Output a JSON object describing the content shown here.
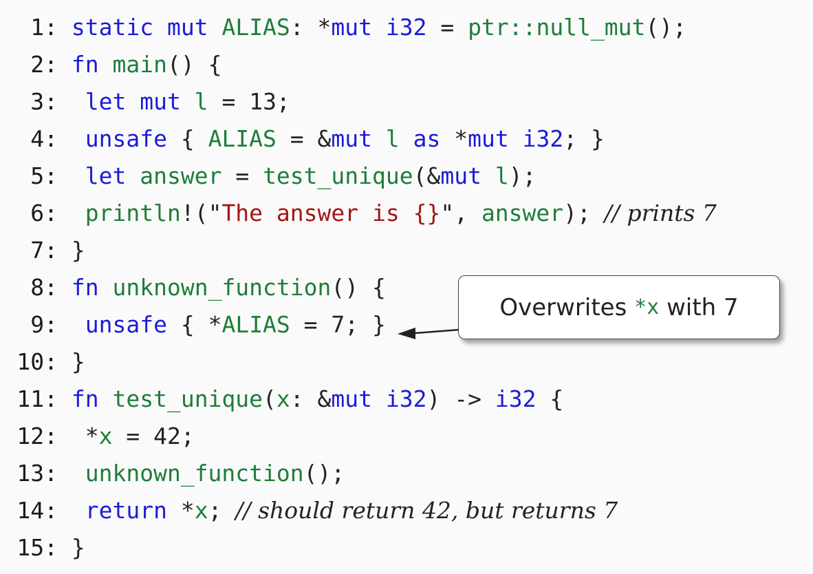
{
  "lines": [
    {
      "num": "1:",
      "tokens": [
        {
          "t": " "
        },
        {
          "t": "static",
          "c": "kw"
        },
        {
          "t": " "
        },
        {
          "t": "mut",
          "c": "kw"
        },
        {
          "t": " "
        },
        {
          "t": "ALIAS",
          "c": "fn"
        },
        {
          "t": ": *"
        },
        {
          "t": "mut",
          "c": "kw"
        },
        {
          "t": " "
        },
        {
          "t": "i32",
          "c": "kw"
        },
        {
          "t": " = "
        },
        {
          "t": "ptr::null_mut",
          "c": "fn"
        },
        {
          "t": "();"
        }
      ]
    },
    {
      "num": "2:",
      "tokens": [
        {
          "t": " "
        },
        {
          "t": "fn",
          "c": "kw"
        },
        {
          "t": " "
        },
        {
          "t": "main",
          "c": "fn"
        },
        {
          "t": "() {"
        }
      ]
    },
    {
      "num": "3:",
      "tokens": [
        {
          "t": "  "
        },
        {
          "t": "let",
          "c": "kw"
        },
        {
          "t": " "
        },
        {
          "t": "mut",
          "c": "kw"
        },
        {
          "t": " "
        },
        {
          "t": "l",
          "c": "fn"
        },
        {
          "t": " = 13;"
        }
      ]
    },
    {
      "num": "4:",
      "tokens": [
        {
          "t": "  "
        },
        {
          "t": "unsafe",
          "c": "kw"
        },
        {
          "t": " { "
        },
        {
          "t": "ALIAS",
          "c": "fn"
        },
        {
          "t": " = &"
        },
        {
          "t": "mut",
          "c": "kw"
        },
        {
          "t": " "
        },
        {
          "t": "l",
          "c": "fn"
        },
        {
          "t": " "
        },
        {
          "t": "as",
          "c": "kw"
        },
        {
          "t": " *"
        },
        {
          "t": "mut",
          "c": "kw"
        },
        {
          "t": " "
        },
        {
          "t": "i32",
          "c": "kw"
        },
        {
          "t": "; }"
        }
      ]
    },
    {
      "num": "5:",
      "tokens": [
        {
          "t": "  "
        },
        {
          "t": "let",
          "c": "kw"
        },
        {
          "t": " "
        },
        {
          "t": "answer",
          "c": "fn"
        },
        {
          "t": " = "
        },
        {
          "t": "test_unique",
          "c": "fn"
        },
        {
          "t": "(&"
        },
        {
          "t": "mut",
          "c": "kw"
        },
        {
          "t": " "
        },
        {
          "t": "l",
          "c": "fn"
        },
        {
          "t": ");"
        }
      ]
    },
    {
      "num": "6:",
      "tokens": [
        {
          "t": "  "
        },
        {
          "t": "println",
          "c": "fn"
        },
        {
          "t": "!(\""
        },
        {
          "t": "The answer is {}",
          "c": "str"
        },
        {
          "t": "\", "
        },
        {
          "t": "answer",
          "c": "fn"
        },
        {
          "t": "); "
        },
        {
          "t": "// prints 7",
          "c": "cm"
        }
      ]
    },
    {
      "num": "7:",
      "tokens": [
        {
          "t": " }"
        }
      ]
    },
    {
      "num": "8:",
      "tokens": [
        {
          "t": " "
        },
        {
          "t": "fn",
          "c": "kw"
        },
        {
          "t": " "
        },
        {
          "t": "unknown_function",
          "c": "fn"
        },
        {
          "t": "() {"
        }
      ]
    },
    {
      "num": "9:",
      "tokens": [
        {
          "t": "  "
        },
        {
          "t": "unsafe",
          "c": "kw"
        },
        {
          "t": " { *"
        },
        {
          "t": "ALIAS",
          "c": "fn"
        },
        {
          "t": " = 7; }"
        }
      ]
    },
    {
      "num": "10:",
      "tokens": [
        {
          "t": " }"
        }
      ]
    },
    {
      "num": "11:",
      "tokens": [
        {
          "t": " "
        },
        {
          "t": "fn",
          "c": "kw"
        },
        {
          "t": " "
        },
        {
          "t": "test_unique",
          "c": "fn"
        },
        {
          "t": "("
        },
        {
          "t": "x",
          "c": "fn"
        },
        {
          "t": ": &"
        },
        {
          "t": "mut",
          "c": "kw"
        },
        {
          "t": " "
        },
        {
          "t": "i32",
          "c": "kw"
        },
        {
          "t": ") -> "
        },
        {
          "t": "i32",
          "c": "kw"
        },
        {
          "t": " {"
        }
      ]
    },
    {
      "num": "12:",
      "tokens": [
        {
          "t": "  *"
        },
        {
          "t": "x",
          "c": "fn"
        },
        {
          "t": " = 42;"
        }
      ]
    },
    {
      "num": "13:",
      "tokens": [
        {
          "t": "  "
        },
        {
          "t": "unknown_function",
          "c": "fn"
        },
        {
          "t": "();"
        }
      ]
    },
    {
      "num": "14:",
      "tokens": [
        {
          "t": "  "
        },
        {
          "t": "return",
          "c": "kw"
        },
        {
          "t": " *"
        },
        {
          "t": "x",
          "c": "fn"
        },
        {
          "t": "; "
        },
        {
          "t": "// should return 42, but returns 7",
          "c": "cm"
        }
      ]
    },
    {
      "num": "15:",
      "tokens": [
        {
          "t": " }"
        }
      ]
    }
  ],
  "callout": {
    "prefix": "Overwrites ",
    "code": "*x",
    "suffix": " with 7"
  },
  "colors": {
    "keyword": "#1b1bd9",
    "identifier": "#1e7d3a",
    "string": "#a31515",
    "text": "#222222",
    "background": "#fafafa"
  }
}
